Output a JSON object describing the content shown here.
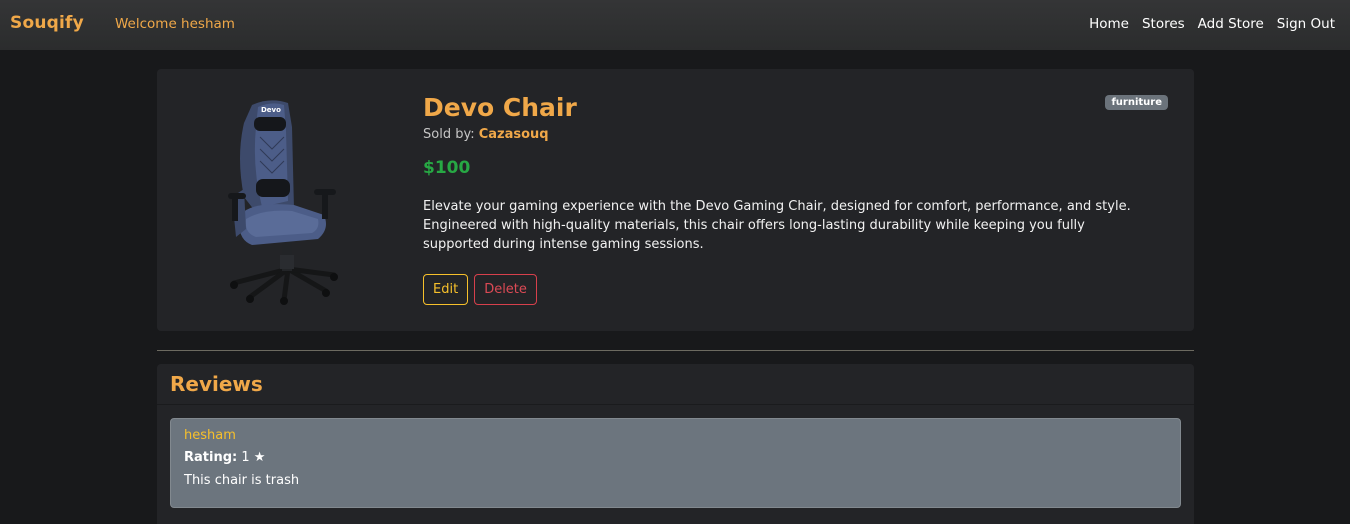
{
  "navbar": {
    "brand": "Souqify",
    "welcome": "Welcome hesham",
    "links": [
      "Home",
      "Stores",
      "Add Store",
      "Sign Out"
    ]
  },
  "product": {
    "title": "Devo Chair",
    "sold_by_label": "Sold by:",
    "store": "Cazasouq",
    "price": "$100",
    "description": "Elevate your gaming experience with the Devo Gaming Chair, designed for comfort, performance, and style. Engineered with high-quality materials, this chair offers long-lasting durability while keeping you fully supported during intense gaming sessions.",
    "category": "furniture",
    "image_logo_text": "Devo",
    "edit_label": "Edit",
    "delete_label": "Delete"
  },
  "reviews": {
    "heading": "Reviews",
    "items": [
      {
        "author": "hesham",
        "rating_label": "Rating:",
        "rating_value": "1 ★",
        "text": "This chair is trash"
      }
    ]
  },
  "colors": {
    "accent": "#f0a849",
    "price": "#27a844",
    "edit": "#f7c02b",
    "delete": "#dc4a55"
  }
}
